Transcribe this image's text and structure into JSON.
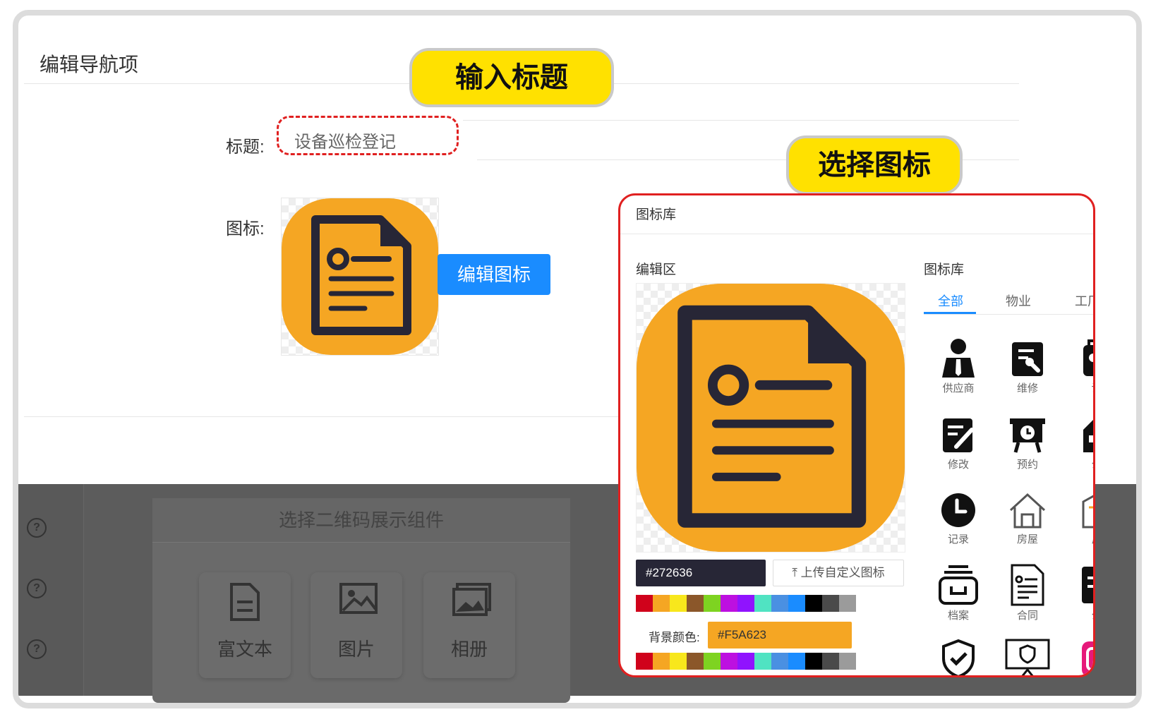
{
  "page": {
    "title": "编辑导航项"
  },
  "callouts": {
    "input_title": "输入标题",
    "choose_icon": "选择图标"
  },
  "form": {
    "title_label": "标题:",
    "title_value": "设备巡检登记",
    "icon_label": "图标:",
    "edit_icon_button": "编辑图标"
  },
  "background_page": {
    "qr_panel_title": "选择二维码展示组件",
    "components": [
      "富文本",
      "图片",
      "相册"
    ],
    "help_icon_glyph": "?"
  },
  "dialog": {
    "title": "图标库",
    "edit_area_label": "编辑区",
    "library_label": "图标库",
    "foreground_hex": "#272636",
    "upload_button": "上传自定义图标",
    "upload_icon_glyph": "⤒",
    "background_label": "背景颜色:",
    "background_hex": "#F5A623",
    "tabs": [
      "全部",
      "物业",
      "工厂"
    ],
    "active_tab": "全部",
    "icons": [
      "供应商",
      "维修",
      "访",
      "修改",
      "预约",
      "公",
      "记录",
      "房屋",
      "反",
      "档案",
      "合同",
      "公"
    ],
    "palette": [
      "#d0021b",
      "#f5a623",
      "#f8e71c",
      "#8b572a",
      "#7ed321",
      "#bd10e0",
      "#9013fe",
      "#50e3c2",
      "#4a90e2",
      "#1a8cff",
      "#000000",
      "#4a4a4a",
      "#9b9b9b",
      "#ffffff"
    ]
  },
  "colors": {
    "accent": "#1a8cff",
    "icon_fg": "#272636",
    "icon_bg": "#F5A623",
    "callout": "#ffe100",
    "highlight": "#e02020"
  }
}
